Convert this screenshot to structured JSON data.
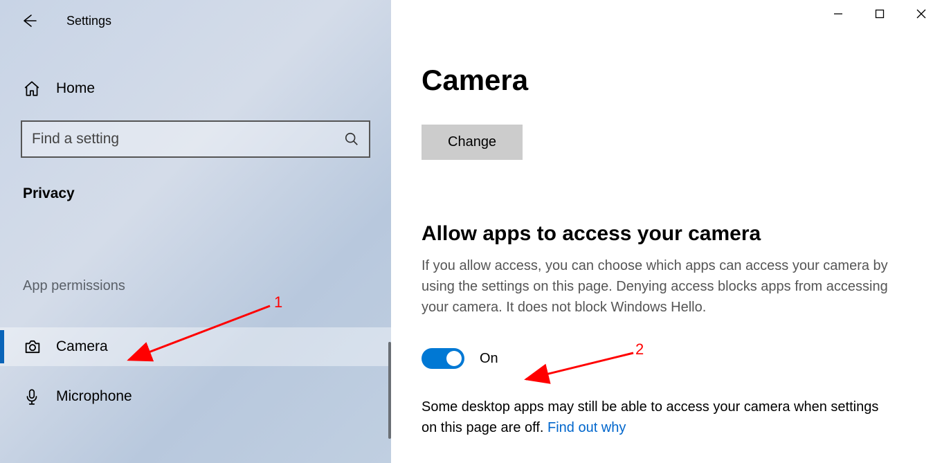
{
  "header": {
    "title": "Settings"
  },
  "sidebar": {
    "home_label": "Home",
    "search_placeholder": "Find a setting",
    "section_label": "Privacy",
    "group_label": "App permissions",
    "items": {
      "camera": "Camera",
      "microphone": "Microphone"
    }
  },
  "main": {
    "page_title": "Camera",
    "change_label": "Change",
    "allow_heading": "Allow apps to access your camera",
    "allow_description": "If you allow access, you can choose which apps can access your camera by using the settings on this page. Denying access blocks apps from accessing your camera. It does not block Windows Hello.",
    "toggle_state": "On",
    "footer_text": "Some desktop apps may still be able to access your camera when settings on this page are off. ",
    "footer_link": "Find out why"
  },
  "annotations": {
    "label1": "1",
    "label2": "2"
  }
}
